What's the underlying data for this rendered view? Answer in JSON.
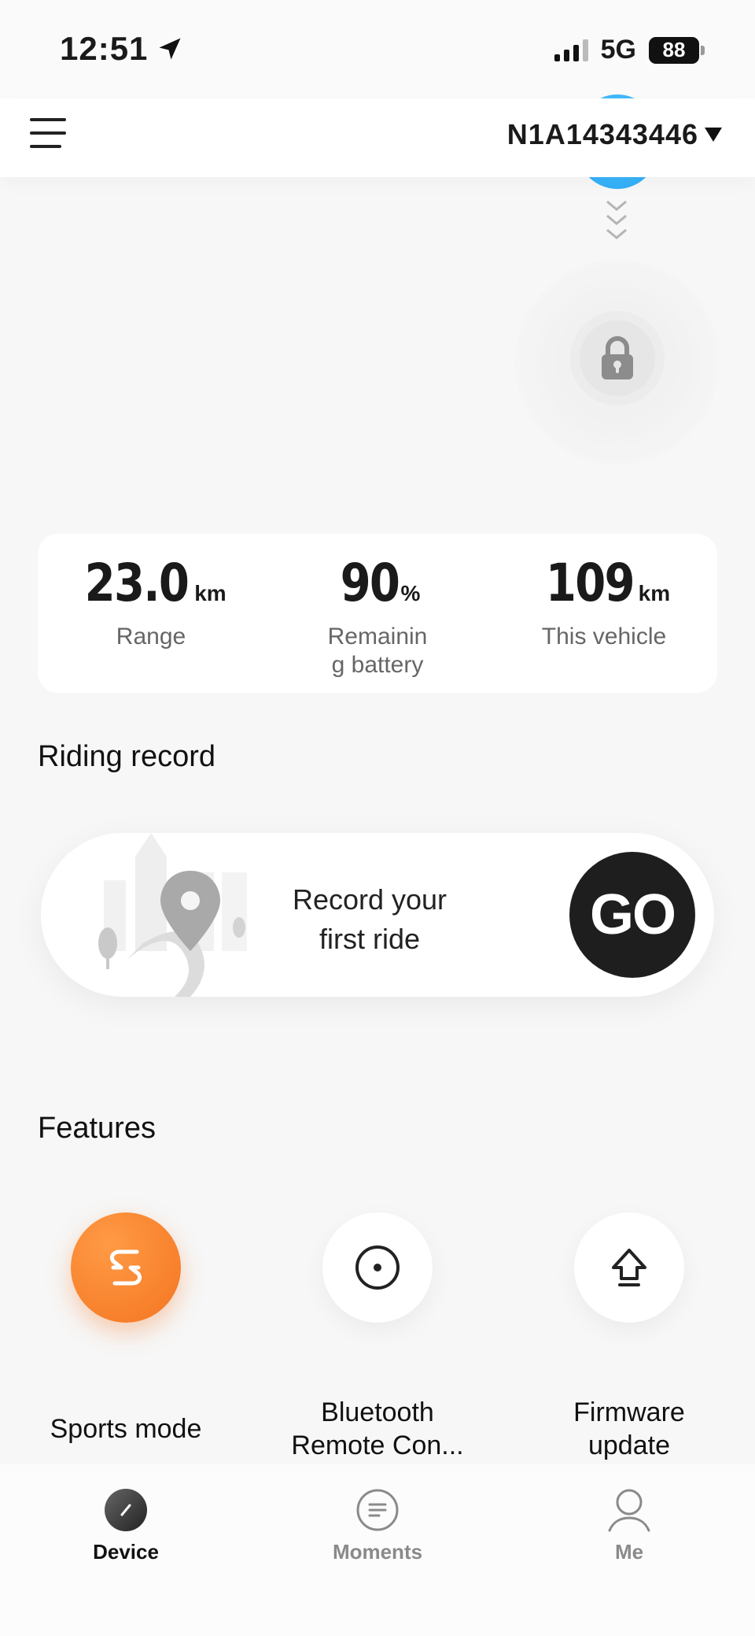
{
  "status_bar": {
    "time": "12:51",
    "network": "5G",
    "battery": "88"
  },
  "header": {
    "device_id": "N1A14343446"
  },
  "stats": [
    {
      "value": "23.0",
      "unit": "km",
      "label": "Range"
    },
    {
      "value": "90",
      "unit": "%",
      "label": "Remainin g battery"
    },
    {
      "value": "109",
      "unit": "km",
      "label": "This vehicle"
    }
  ],
  "riding_record": {
    "title": "Riding record",
    "prompt_line1": "Record your",
    "prompt_line2": "first ride",
    "go_label": "GO"
  },
  "features": {
    "title": "Features",
    "items": [
      {
        "line1": "Sports mode",
        "line2": "",
        "icon": "sports-mode-icon"
      },
      {
        "line1": "Bluetooth",
        "line2": "Remote Con...",
        "icon": "bluetooth-remote-icon"
      },
      {
        "line1": "Firmware",
        "line2": "update",
        "icon": "firmware-update-icon"
      }
    ]
  },
  "bottom_nav": [
    {
      "label": "Device",
      "active": true
    },
    {
      "label": "Moments",
      "active": false
    },
    {
      "label": "Me",
      "active": false
    }
  ],
  "colors": {
    "accent_orange": "#f47521",
    "go_button": "#1e1e1e",
    "nav_inactive": "#8a8a8a",
    "blue_indicator": "#2aa8f5"
  }
}
